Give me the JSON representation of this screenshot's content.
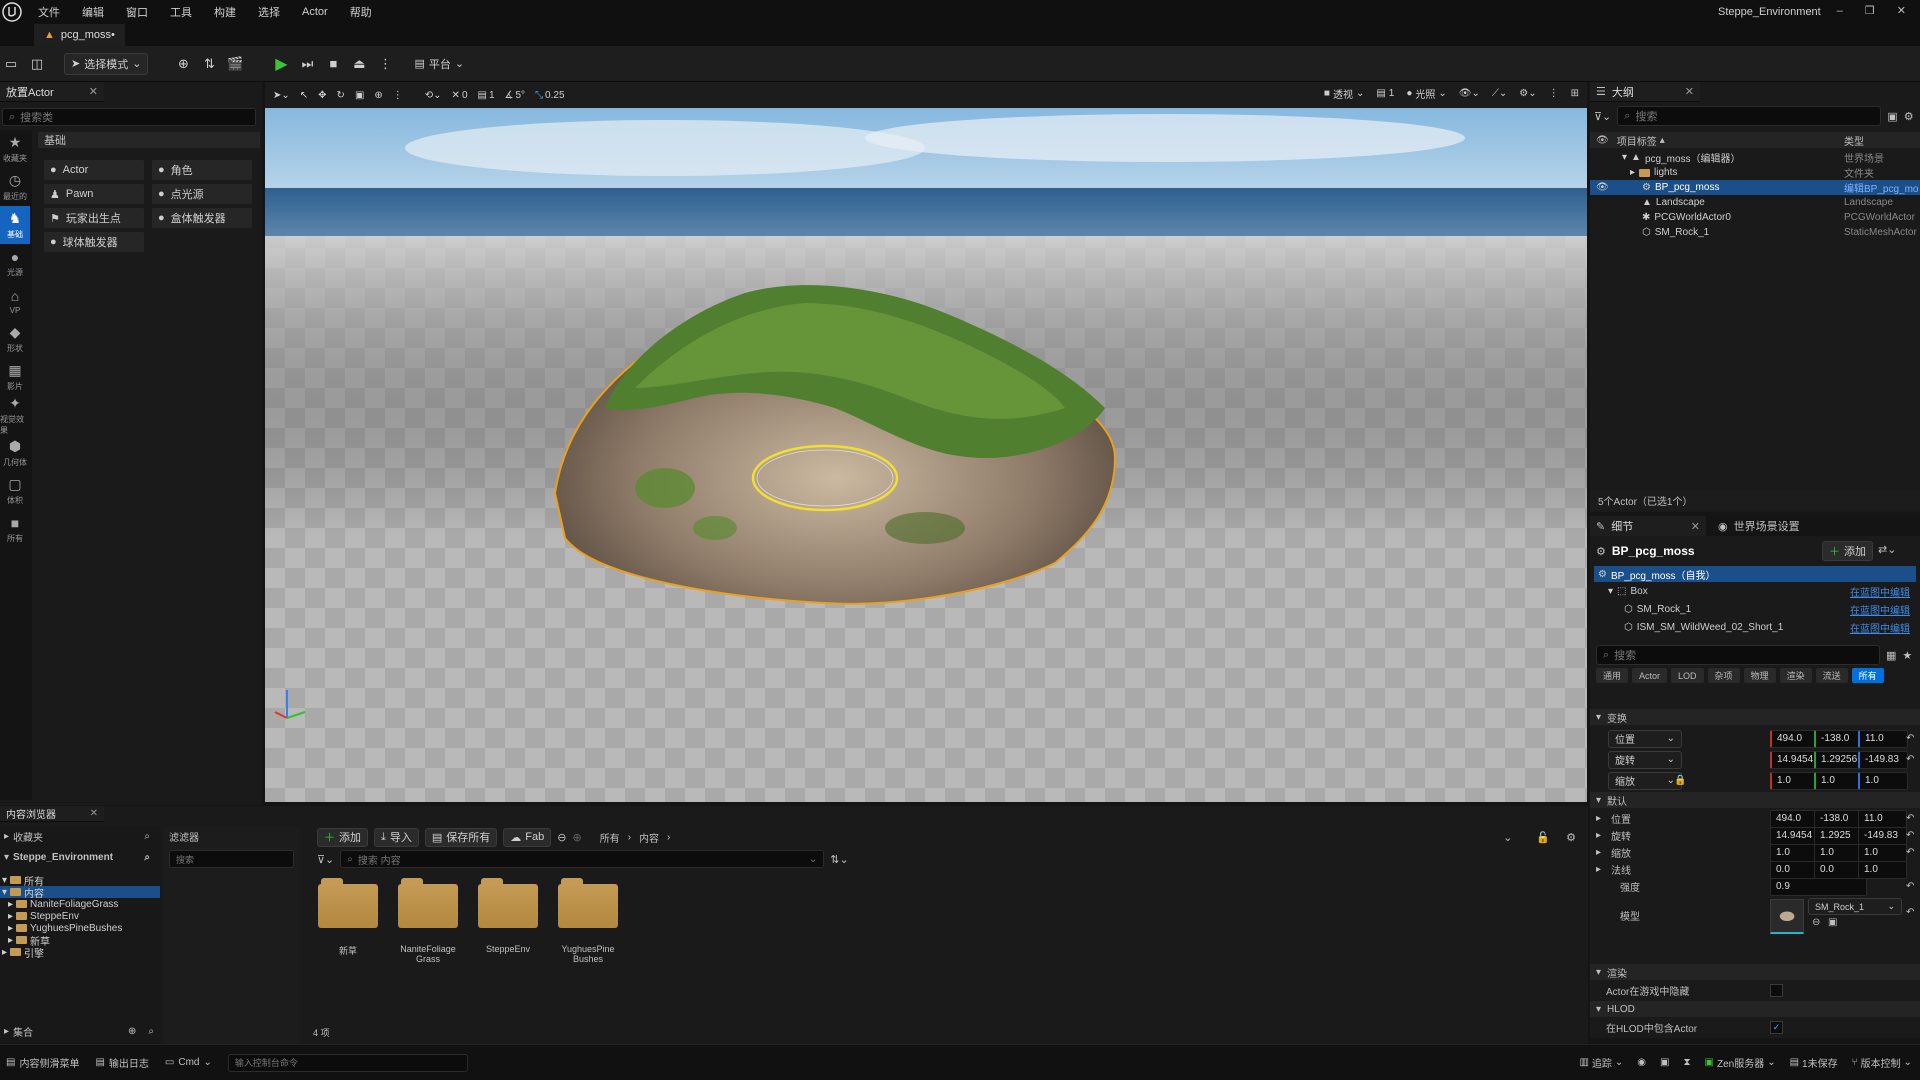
{
  "menu": [
    "文件",
    "编辑",
    "窗口",
    "工具",
    "构建",
    "选择",
    "Actor",
    "帮助"
  ],
  "project_name": "Steppe_Environment",
  "doc_tab": "pcg_moss•",
  "toolbar": {
    "mode_label": "选择模式",
    "platform_label": "平台"
  },
  "place_actors": {
    "tab": "放置Actor",
    "search_placeholder": "搜索类",
    "section": "基础",
    "items": [
      "Actor",
      "角色",
      "Pawn",
      "点光源",
      "玩家出生点",
      "盒体触发器",
      "球体触发器"
    ],
    "side_labels": [
      "收藏夹",
      "最近的",
      "基础",
      "光源",
      "VP",
      "形状",
      "影片",
      "视觉效果",
      "几何体",
      "体积",
      "所有"
    ]
  },
  "viewport": {
    "perspective": "透视",
    "lit": "光照",
    "snap_angle": "5°",
    "grid": "0",
    "scale_snap": "0.25",
    "camera_speed": "1",
    "layers": "1"
  },
  "outliner": {
    "tab": "大纲",
    "search_placeholder": "搜索",
    "col_label": "项目标签",
    "col_type": "类型",
    "rows": [
      {
        "label": "pcg_moss（编辑器）",
        "type": "世界场景",
        "indent": 1
      },
      {
        "label": "lights",
        "type": "文件夹",
        "indent": 2
      },
      {
        "label": "BP_pcg_moss",
        "type": "编辑BP_pcg_mo",
        "indent": 3,
        "selected": true
      },
      {
        "label": "Landscape",
        "type": "Landscape",
        "indent": 3
      },
      {
        "label": "PCGWorldActor0",
        "type": "PCGWorldActor",
        "indent": 3
      },
      {
        "label": "SM_Rock_1",
        "type": "StaticMeshActor",
        "indent": 3
      }
    ],
    "footer": "5个Actor（已选1个）"
  },
  "details": {
    "tab": "细节",
    "tab2": "世界场景设置",
    "title": "BP_pcg_moss",
    "add_label": "添加",
    "components": [
      {
        "label": "BP_pcg_moss（自我）",
        "link": ""
      },
      {
        "label": "Box",
        "link": "在蓝图中编辑"
      },
      {
        "label": "SM_Rock_1",
        "link": "在蓝图中编辑"
      },
      {
        "label": "ISM_SM_WildWeed_02_Short_1",
        "link": "在蓝图中编辑"
      }
    ],
    "search_placeholder": "搜索",
    "filters": [
      "通用",
      "Actor",
      "LOD",
      "杂项",
      "物理",
      "渲染",
      "流送",
      "所有"
    ],
    "transform_header": "变换",
    "transform": [
      {
        "label": "位置",
        "x": "494.0",
        "y": "-138.0",
        "z": "11.0"
      },
      {
        "label": "旋转",
        "x": "14.9454",
        "y": "1.29256",
        "z": "-149.83"
      },
      {
        "label": "缩放",
        "x": "1.0",
        "y": "1.0",
        "z": "1.0"
      }
    ],
    "default_header": "默认",
    "default": [
      {
        "label": "位置",
        "x": "494.0",
        "y": "-138.0",
        "z": "11.0"
      },
      {
        "label": "旋转",
        "x": "14.9454",
        "y": "1.2925",
        "z": "-149.83"
      },
      {
        "label": "缩放",
        "x": "1.0",
        "y": "1.0",
        "z": "1.0"
      },
      {
        "label": "法线",
        "x": "0.0",
        "y": "0.0",
        "z": "1.0"
      }
    ],
    "strength_label": "强度",
    "strength": "0.9",
    "model_label": "模型",
    "model_value": "SM_Rock_1",
    "render_header": "渲染",
    "render_prop": "Actor在游戏中隐藏",
    "hlod_header": "HLOD",
    "hlod_prop": "在HLOD中包含Actor"
  },
  "content_browser": {
    "tab": "内容浏览器",
    "favorites": "收藏夹",
    "project": "Steppe_Environment",
    "filters_label": "滤滤器",
    "filters_search": "搜索",
    "buttons": [
      "添加",
      "导入",
      "保存所有",
      "Fab"
    ],
    "path": [
      "所有",
      "内容"
    ],
    "search_placeholder": "搜索 内容",
    "tree": [
      "所有",
      "内容",
      "NaniteFoliageGrass",
      "SteppeEnv",
      "YughuesPineBushes",
      "新草",
      "引擎"
    ],
    "folders": [
      "新草",
      "NaniteFoliage Grass",
      "SteppeEnv",
      "YughuesPine Bushes"
    ],
    "collections": "集合",
    "count": "4 项"
  },
  "statusbar": {
    "items": [
      "内容侧滑菜单",
      "输出日志",
      "Cmd"
    ],
    "console_placeholder": "输入控制台命令",
    "right": [
      "追踪",
      "Zen服务器",
      "1未保存",
      "版本控制"
    ]
  },
  "colors": {
    "accent": "#0070e0",
    "selected_row": "#1b4f8a",
    "link": "#3d8ce8",
    "folder": "#c49a55",
    "play": "#3cc43c"
  }
}
